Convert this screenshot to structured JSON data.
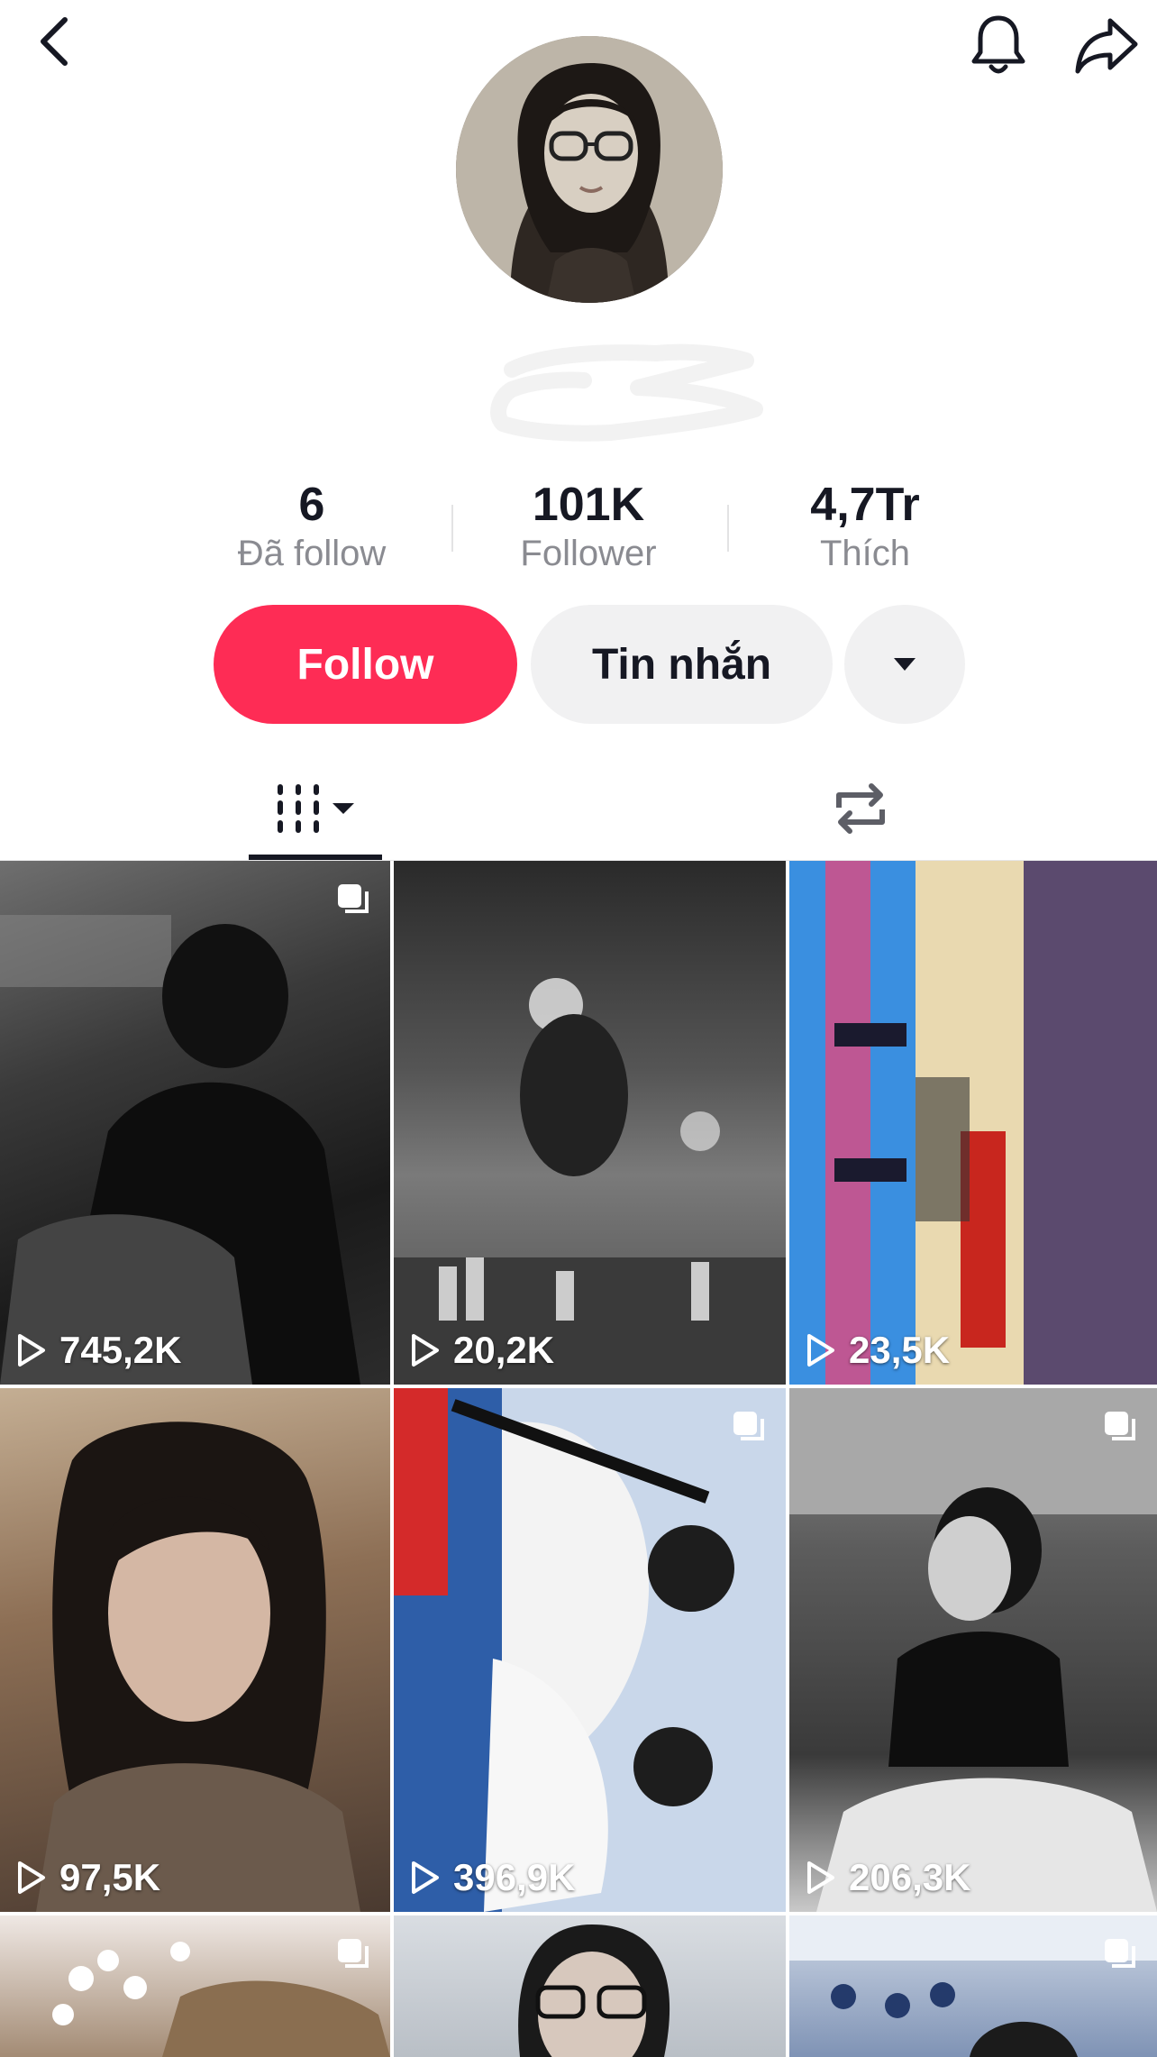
{
  "header": {
    "back_icon": "chevron-left-icon",
    "bell_icon": "bell-icon",
    "share_icon": "share-arrow-icon"
  },
  "profile": {
    "avatar": "profile-photo"
  },
  "stats": [
    {
      "value": "6",
      "label": "Đã follow"
    },
    {
      "value": "101K",
      "label": "Follower"
    },
    {
      "value": "4,7Tr",
      "label": "Thích"
    }
  ],
  "actions": {
    "follow_label": "Follow",
    "message_label": "Tin nhắn",
    "more_icon": "caret-down-icon"
  },
  "colors": {
    "accent": "#fe2c55",
    "button_gray": "#f1f1f2",
    "text_primary": "#161823",
    "text_secondary": "#8a8b91"
  },
  "tabs": [
    {
      "name": "videos",
      "icon": "grid-columns-icon",
      "selected": true
    },
    {
      "name": "reposts",
      "icon": "repost-icon",
      "selected": false
    }
  ],
  "videos": [
    {
      "views": "745,2K",
      "multi": true
    },
    {
      "views": "20,2K",
      "multi": false
    },
    {
      "views": "23,5K",
      "multi": false
    },
    {
      "views": "97,5K",
      "multi": false
    },
    {
      "views": "396,9K",
      "multi": true
    },
    {
      "views": "206,3K",
      "multi": true
    },
    {
      "views": "",
      "multi": true
    },
    {
      "views": "",
      "multi": false
    },
    {
      "views": "",
      "multi": true
    }
  ]
}
